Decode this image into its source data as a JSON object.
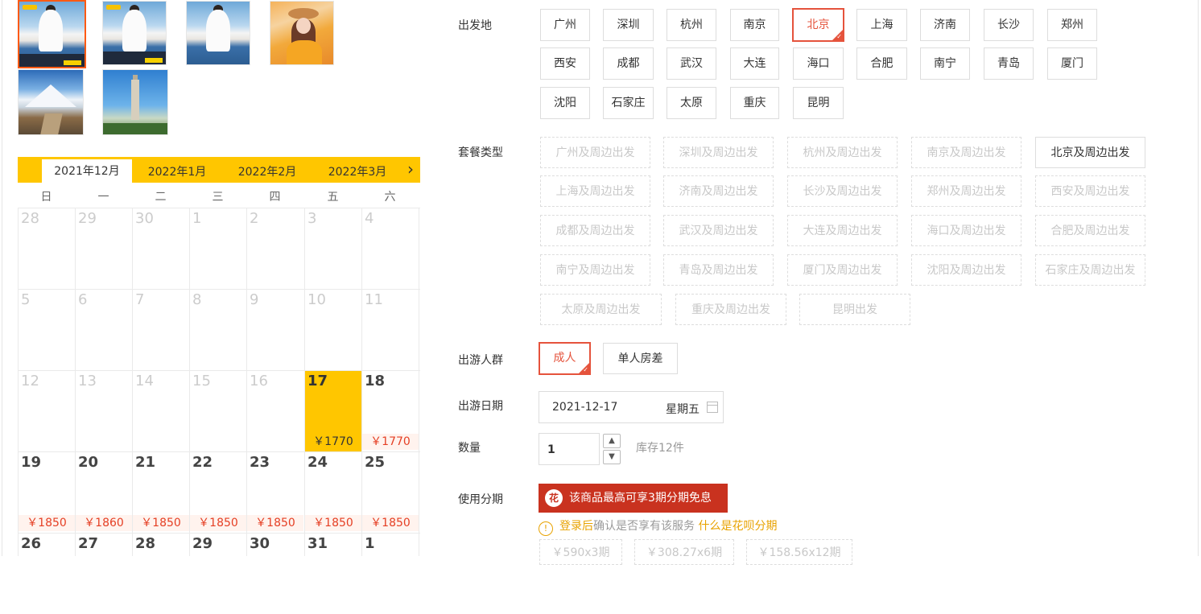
{
  "gallery": [
    "lake-photo",
    "lake-photo",
    "lake-photo",
    "girl-photo",
    "snow-mountain-photo",
    "pagoda-photo"
  ],
  "calendar": {
    "tabs": [
      "2021年12月",
      "2022年1月",
      "2022年2月",
      "2022年3月"
    ],
    "active_tab": "2021年12月",
    "next_icon": "chevron-right-icon",
    "weekdays": [
      "日",
      "一",
      "二",
      "三",
      "四",
      "五",
      "六"
    ],
    "weeks": [
      [
        {
          "d": "28",
          "inactive": true
        },
        {
          "d": "29",
          "inactive": true
        },
        {
          "d": "30",
          "inactive": true
        },
        {
          "d": "1",
          "inactive": true
        },
        {
          "d": "2",
          "inactive": true
        },
        {
          "d": "3",
          "inactive": true
        },
        {
          "d": "4",
          "inactive": true
        }
      ],
      [
        {
          "d": "5",
          "inactive": true
        },
        {
          "d": "6",
          "inactive": true
        },
        {
          "d": "7",
          "inactive": true
        },
        {
          "d": "8",
          "inactive": true
        },
        {
          "d": "9",
          "inactive": true
        },
        {
          "d": "10",
          "inactive": true
        },
        {
          "d": "11",
          "inactive": true
        }
      ],
      [
        {
          "d": "12",
          "inactive": true
        },
        {
          "d": "13",
          "inactive": true
        },
        {
          "d": "14",
          "inactive": true
        },
        {
          "d": "15",
          "inactive": true
        },
        {
          "d": "16",
          "inactive": true
        },
        {
          "d": "17",
          "price": "￥1770",
          "selected": true
        },
        {
          "d": "18",
          "price": "￥1770"
        }
      ],
      [
        {
          "d": "19",
          "price": "￥1850"
        },
        {
          "d": "20",
          "price": "￥1860"
        },
        {
          "d": "21",
          "price": "￥1850"
        },
        {
          "d": "22",
          "price": "￥1850"
        },
        {
          "d": "23",
          "price": "￥1850"
        },
        {
          "d": "24",
          "price": "￥1850"
        },
        {
          "d": "25",
          "price": "￥1850"
        }
      ],
      [
        {
          "d": "26"
        },
        {
          "d": "27"
        },
        {
          "d": "28"
        },
        {
          "d": "29"
        },
        {
          "d": "30"
        },
        {
          "d": "31"
        },
        {
          "d": "1"
        }
      ]
    ]
  },
  "options": {
    "departure": {
      "label": "出发地",
      "items": [
        "广州",
        "深圳",
        "杭州",
        "南京",
        "北京",
        "上海",
        "济南",
        "长沙",
        "郑州",
        "西安",
        "成都",
        "武汉",
        "大连",
        "海口",
        "合肥",
        "南宁",
        "青岛",
        "厦门",
        "沈阳",
        "石家庄",
        "太原",
        "重庆",
        "昆明"
      ],
      "selected": "北京"
    },
    "package": {
      "label": "套餐类型",
      "items": [
        "广州及周边出发",
        "深圳及周边出发",
        "杭州及周边出发",
        "南京及周边出发",
        "北京及周边出发",
        "上海及周边出发",
        "济南及周边出发",
        "长沙及周边出发",
        "郑州及周边出发",
        "西安及周边出发",
        "成都及周边出发",
        "武汉及周边出发",
        "大连及周边出发",
        "海口及周边出发",
        "合肥及周边出发",
        "南宁及周边出发",
        "青岛及周边出发",
        "厦门及周边出发",
        "沈阳及周边出发",
        "石家庄及周边出发",
        "太原及周边出发",
        "重庆及周边出发",
        "昆明出发"
      ],
      "enabled": "北京及周边出发"
    },
    "travelers": {
      "label": "出游人群",
      "items": [
        "成人",
        "单人房差"
      ],
      "selected": "成人"
    },
    "date": {
      "label": "出游日期",
      "value": "2021-12-17",
      "weekday": "星期五",
      "icon": "calendar-icon"
    },
    "quantity": {
      "label": "数量",
      "value": "1",
      "up": "▲",
      "down": "▼",
      "stock": "库存12件"
    },
    "installment": {
      "label": "使用分期",
      "banner": "该商品最高可享3期分期免息",
      "banner_icon": "花",
      "info_icon": "!",
      "login_link": "登录后",
      "login_text": "确认是否享有该服务",
      "what_link": "什么是花呗分期",
      "plans": [
        "￥590x3期",
        "￥308.27x6期",
        "￥158.56x12期"
      ]
    }
  },
  "colors": {
    "accent": "#ffc600",
    "selected": "#e5533c",
    "price": "#e53f24",
    "huabei": "#c9321f"
  }
}
